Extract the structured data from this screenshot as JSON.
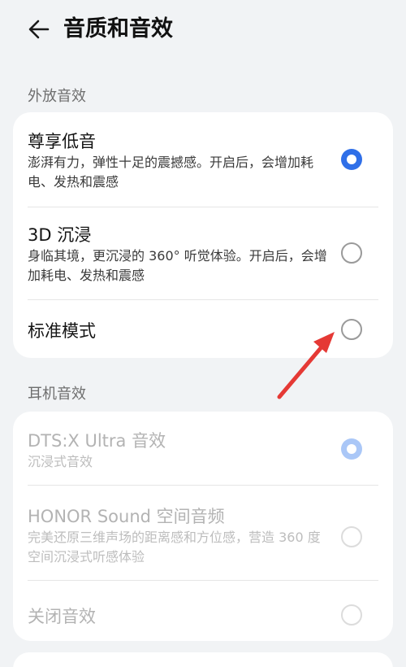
{
  "header": {
    "back_icon": "back-arrow-icon",
    "title": "音质和音效"
  },
  "speaker_section": {
    "label": "外放音效",
    "options": [
      {
        "title": "尊享低音",
        "desc": "澎湃有力，弹性十足的震撼感。开启后，会增加耗电、发热和震感",
        "selected": true
      },
      {
        "title": "3D 沉浸",
        "desc": "身临其境，更沉浸的 360° 听觉体验。开启后，会增加耗电、发热和震感",
        "selected": false
      },
      {
        "title": "标准模式",
        "selected": false
      }
    ]
  },
  "headphone_section": {
    "label": "耳机音效",
    "disabled": true,
    "options": [
      {
        "title": "DTS:X Ultra 音效",
        "desc": "沉浸式音效",
        "selected": true
      },
      {
        "title": "HONOR Sound 空间音频",
        "desc": "完美还原三维声场的距离感和方位感，营造 360 度空间沉浸式听感体验",
        "selected": false
      },
      {
        "title": "关闭音效",
        "selected": false
      }
    ]
  },
  "annotation": {
    "arrow_color": "#e53935"
  },
  "colors": {
    "accent": "#2f6fe8",
    "background": "#f1f3f5",
    "card": "#ffffff"
  }
}
